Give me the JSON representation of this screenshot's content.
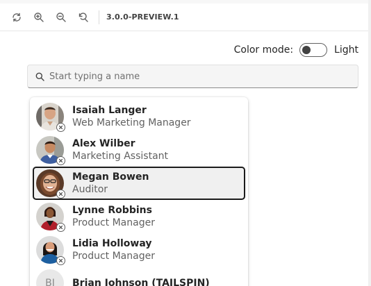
{
  "toolbar": {
    "icons": [
      "refresh-icon",
      "zoom-in-icon",
      "zoom-out-icon",
      "reset-zoom-icon"
    ],
    "version": "3.0.0-PREVIEW.1"
  },
  "color_mode": {
    "label": "Color mode:",
    "value": "Light"
  },
  "search": {
    "placeholder": "Start typing a name",
    "value": ""
  },
  "people": [
    {
      "name": "Isaiah Langer",
      "role": "Web Marketing Manager",
      "selected": false
    },
    {
      "name": "Alex Wilber",
      "role": "Marketing Assistant",
      "selected": false
    },
    {
      "name": "Megan Bowen",
      "role": "Auditor",
      "selected": true
    },
    {
      "name": "Lynne Robbins",
      "role": "Product Manager",
      "selected": false
    },
    {
      "name": "Lidia Holloway",
      "role": "Product Manager",
      "selected": false
    },
    {
      "name": "Brian Johnson (TAILSPIN)",
      "role": "",
      "initials": "BJ",
      "selected": false
    }
  ]
}
